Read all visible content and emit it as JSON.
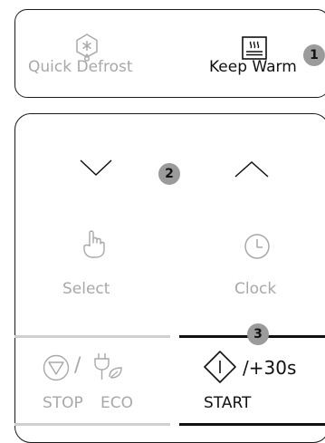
{
  "top_panel": {
    "quick_defrost_label": "Quick Defrost",
    "keep_warm_label": "Keep Warm",
    "badge": "1"
  },
  "bottom_panel": {
    "badge_arrows": "2",
    "select_label": "Select",
    "clock_label": "Clock",
    "badge_start": "3",
    "stop_label": "STOP",
    "eco_label": "ECO",
    "stop_eco_separator": "/",
    "start_label": "START",
    "plus30_label": "/+30s"
  },
  "icons": {
    "quick_defrost": "snowflake-drop-icon",
    "keep_warm": "steam-plate-icon",
    "down": "chevron-down-icon",
    "up": "chevron-up-icon",
    "select": "hand-pointer-icon",
    "clock": "clock-icon",
    "stop": "stop-triangle-icon",
    "eco": "plug-leaf-icon",
    "start": "start-diamond-icon"
  },
  "colors": {
    "active": "#111111",
    "inactive": "#a8a8a8",
    "badge": "#9b9b9b"
  }
}
